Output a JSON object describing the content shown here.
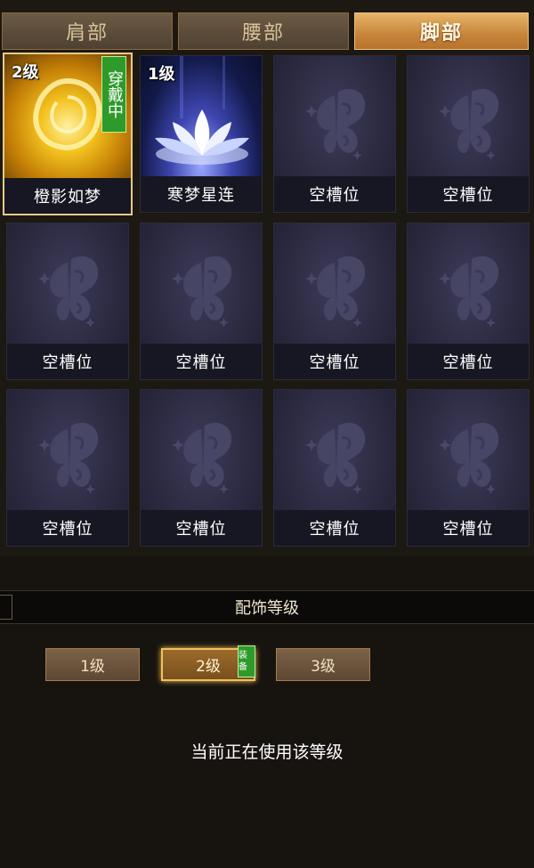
{
  "tabs": [
    {
      "label": "肩部",
      "active": false
    },
    {
      "label": "腰部",
      "active": false
    },
    {
      "label": "脚部",
      "active": true
    }
  ],
  "slots": [
    {
      "name": "橙影如梦",
      "level": "2级",
      "wearing": "穿戴中",
      "type": "gold"
    },
    {
      "name": "寒梦星连",
      "level": "1级",
      "type": "blue"
    },
    {
      "name": "空槽位",
      "type": "empty"
    },
    {
      "name": "空槽位",
      "type": "empty"
    },
    {
      "name": "空槽位",
      "type": "empty"
    },
    {
      "name": "空槽位",
      "type": "empty"
    },
    {
      "name": "空槽位",
      "type": "empty"
    },
    {
      "name": "空槽位",
      "type": "empty"
    },
    {
      "name": "空槽位",
      "type": "empty"
    },
    {
      "name": "空槽位",
      "type": "empty"
    },
    {
      "name": "空槽位",
      "type": "empty"
    },
    {
      "name": "空槽位",
      "type": "empty"
    }
  ],
  "section": {
    "title": "配饰等级"
  },
  "level_buttons": [
    {
      "label": "1级",
      "active": false
    },
    {
      "label": "2级",
      "active": true
    },
    {
      "label": "3级",
      "active": false
    }
  ],
  "equip_badge": "装备",
  "status": "当前正在使用该等级",
  "colors": {
    "accent": "#c7853a",
    "equipped": "#2e9a2a",
    "slot_bg": "#2a293f"
  }
}
